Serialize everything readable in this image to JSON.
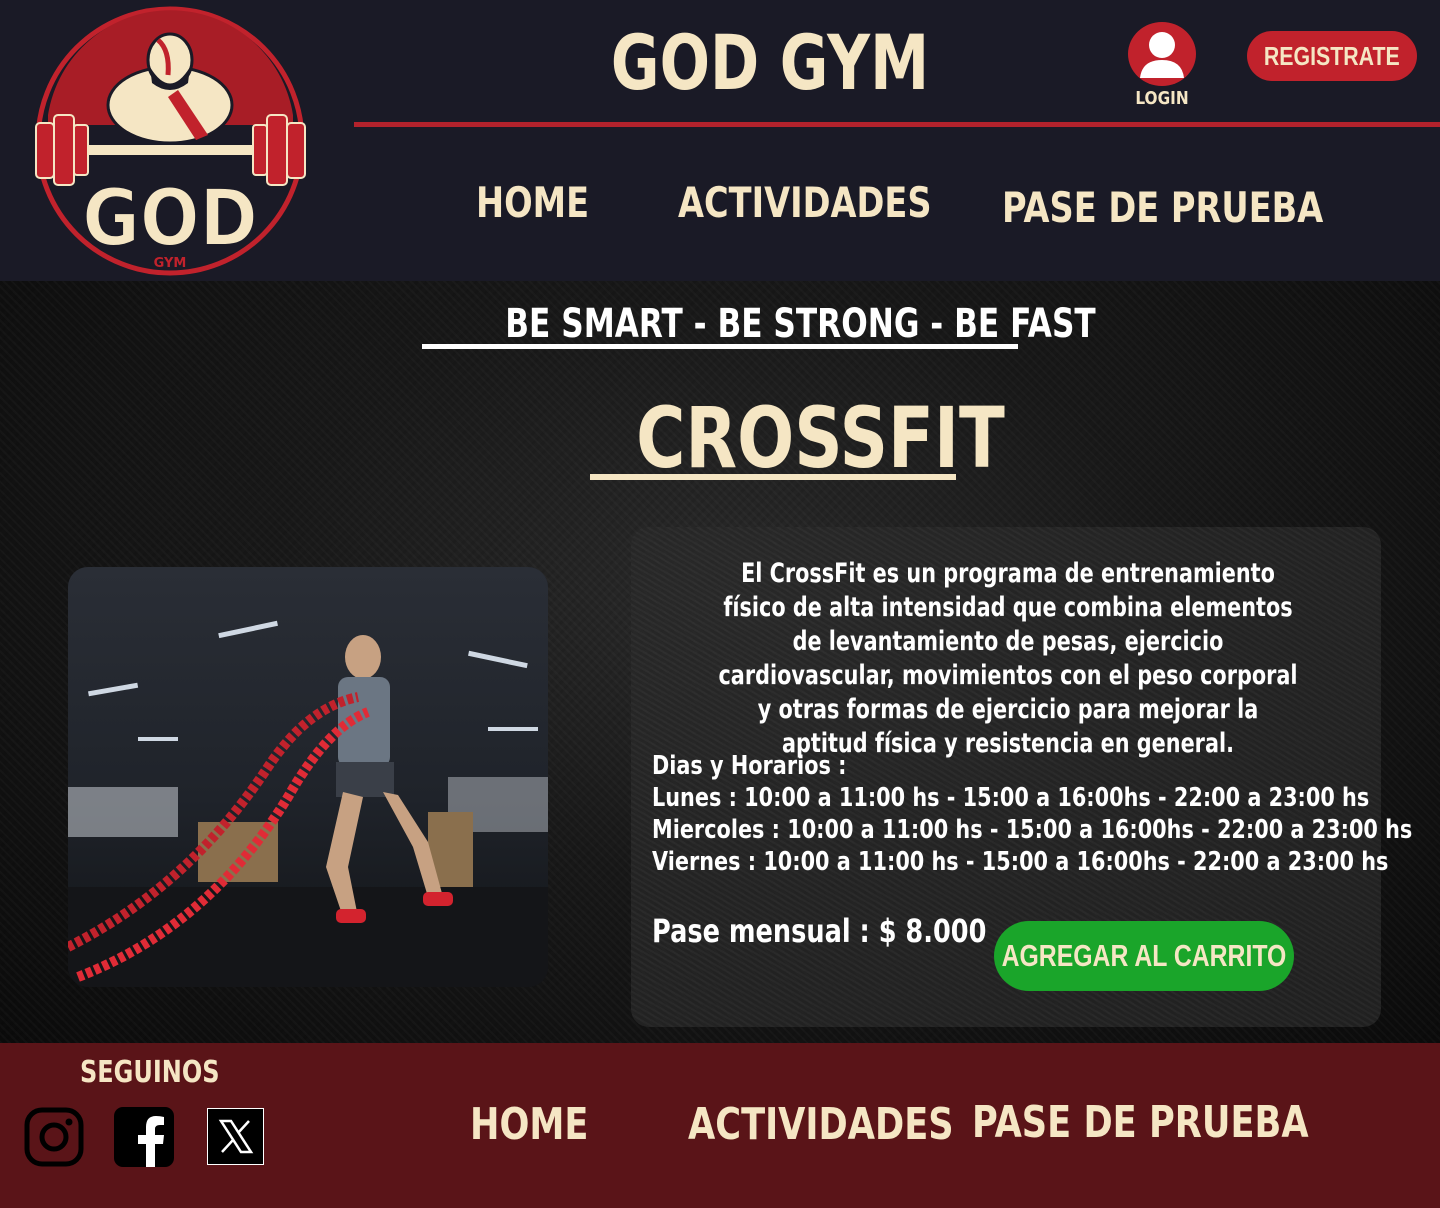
{
  "header": {
    "logo_text": "GOD",
    "logo_subtext": "GYM",
    "title": "GOD GYM",
    "login_label": "LOGIN",
    "register_label": "REGISTRATE",
    "nav": [
      "HOME",
      "ACTIVIDADES",
      "PASE DE PRUEBA"
    ]
  },
  "main": {
    "slogan": "BE SMART - BE STRONG - BE FAST",
    "title": "CROSSFIT",
    "description": "El CrossFit es un programa de entrenamiento físico de alta intensidad que combina elementos de levantamiento de pesas, ejercicio cardiovascular, movimientos con el peso corporal y otras formas de ejercicio para mejorar la aptitud física y resistencia en general.",
    "schedule_title": "Dias y Horarios :",
    "schedule": [
      "Lunes : 10:00 a 11:00 hs - 15:00 a 16:00hs - 22:00 a 23:00 hs",
      "Miercoles : 10:00 a 11:00 hs - 15:00 a 16:00hs - 22:00 a 23:00 hs",
      "Viernes :  10:00 a 11:00 hs - 15:00 a 16:00hs - 22:00 a 23:00 hs"
    ],
    "price": "Pase mensual : $ 8.000",
    "cart_button": "AGREGAR AL CARRITO"
  },
  "footer": {
    "follow_label": "SEGUINOS",
    "social_icons": [
      "instagram-icon",
      "facebook-icon",
      "x-icon"
    ],
    "nav": [
      "HOME",
      "ACTIVIDADES",
      "PASE DE PRUEBA"
    ]
  },
  "colors": {
    "header_bg": "#1a1a26",
    "accent_red": "#c1222c",
    "cream": "#f5e6c4",
    "cart_green": "#1aa52a",
    "footer_bg": "#5a1418"
  }
}
